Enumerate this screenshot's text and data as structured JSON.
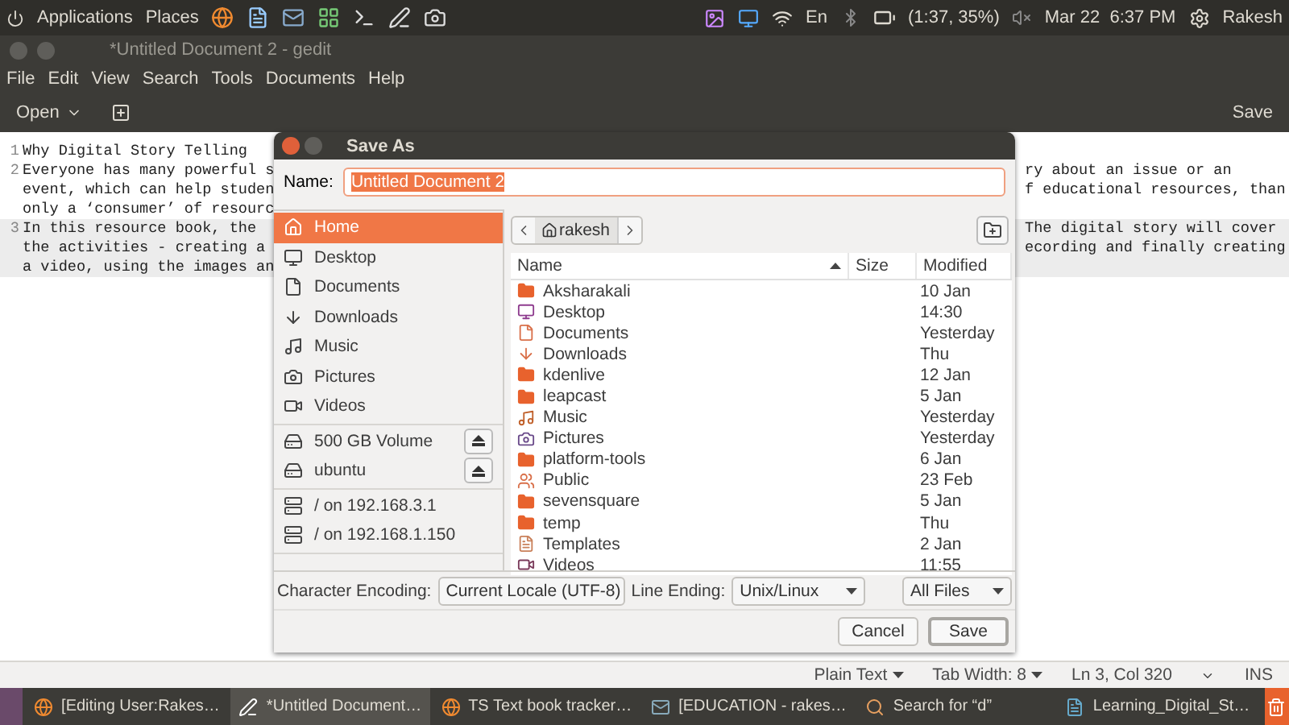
{
  "top_panel": {
    "menus": [
      "Applications",
      "Places"
    ],
    "keyboard": "En",
    "battery": "(1:37, 35%)",
    "clock": "Mar 22  6:37 PM",
    "user": "Rakesh"
  },
  "window": {
    "title": "*Untitled Document 2 - gedit"
  },
  "menu_bar": [
    "File",
    "Edit",
    "View",
    "Search",
    "Tools",
    "Documents",
    "Help"
  ],
  "toolbar": {
    "open": "Open",
    "save": "Save"
  },
  "editor": {
    "lines": [
      {
        "number": "1",
        "current": false,
        "rows": [
          {
            "left": "Why Digital Story Telling"
          }
        ]
      },
      {
        "number": "2",
        "current": false,
        "rows": [
          {
            "left": "Everyone has many powerful s",
            "right": "ry about an issue or an"
          },
          {
            "left": "event, which can help studen",
            "right": "f educational resources, than"
          },
          {
            "left": "only a ‘consumer’ of resourc"
          }
        ]
      },
      {
        "number": "3",
        "current": true,
        "rows": [
          {
            "left": "In this resource book, the ",
            "right": "The digital story will cover"
          },
          {
            "left": "the activities - creating a",
            "right": "ecording and finally creating"
          },
          {
            "left": "a video, using the images an"
          }
        ]
      }
    ]
  },
  "dialog": {
    "title": "Save As",
    "name_label": "Name:",
    "name_value": "Untitled Document 2",
    "name_selected": true,
    "sidebar": [
      [
        {
          "label": "Home",
          "kind": "home",
          "selected": true
        },
        {
          "label": "Desktop",
          "kind": "desktop",
          "selected": false
        },
        {
          "label": "Documents",
          "kind": "documents",
          "selected": false
        },
        {
          "label": "Downloads",
          "kind": "downloads",
          "selected": false
        },
        {
          "label": "Music",
          "kind": "music",
          "selected": false
        },
        {
          "label": "Pictures",
          "kind": "pictures",
          "selected": false
        },
        {
          "label": "Videos",
          "kind": "videos",
          "selected": false
        }
      ],
      [
        {
          "label": "500 GB Volume",
          "kind": "drive",
          "selected": false
        },
        {
          "label": "ubuntu",
          "kind": "drive",
          "selected": false
        }
      ],
      [
        {
          "label": "/ on 192.168.3.1",
          "kind": "network",
          "selected": false
        },
        {
          "label": "/ on 192.168.1.150",
          "kind": "network",
          "selected": false
        }
      ]
    ],
    "path": {
      "crumb": "rakesh"
    },
    "columns": [
      {
        "label": "Name",
        "sorted": true
      },
      {
        "label": "Size",
        "sorted": false
      },
      {
        "label": "Modified",
        "sorted": false
      }
    ],
    "files": [
      {
        "name": "Aksharakali",
        "kind": "folder",
        "modified": "10 Jan"
      },
      {
        "name": "Desktop",
        "kind": "desktop",
        "modified": "14:30"
      },
      {
        "name": "Documents",
        "kind": "documents",
        "modified": "Yesterday"
      },
      {
        "name": "Downloads",
        "kind": "downloads",
        "modified": "Thu"
      },
      {
        "name": "kdenlive",
        "kind": "folder",
        "modified": "12 Jan"
      },
      {
        "name": "leapcast",
        "kind": "folder",
        "modified": "5 Jan"
      },
      {
        "name": "Music",
        "kind": "music",
        "modified": "Yesterday"
      },
      {
        "name": "Pictures",
        "kind": "pictures",
        "modified": "Yesterday"
      },
      {
        "name": "platform-tools",
        "kind": "folder",
        "modified": "6 Jan"
      },
      {
        "name": "Public",
        "kind": "public",
        "modified": "23 Feb"
      },
      {
        "name": "sevensquare",
        "kind": "folder",
        "modified": "5 Jan"
      },
      {
        "name": "temp",
        "kind": "folder",
        "modified": "Thu"
      },
      {
        "name": "Templates",
        "kind": "templates",
        "modified": "2 Jan"
      },
      {
        "name": "Videos",
        "kind": "videos",
        "modified": "11:55"
      }
    ],
    "encoding_label": "Character Encoding:",
    "encoding": "Current Locale (UTF-8)",
    "line_ending_label": "Line Ending:",
    "line_ending": "Unix/Linux",
    "filter": "All Files",
    "buttons": [
      {
        "label": "Cancel",
        "default": false
      },
      {
        "label": "Save",
        "default": true
      }
    ]
  },
  "status_bar": {
    "language": "Plain Text",
    "tab_width": "Tab Width: 8",
    "position": "Ln 3, Col 320",
    "mode": "INS"
  },
  "taskbar": [
    {
      "label": "[Editing User:Rakes…",
      "kind": "browser",
      "selected": false
    },
    {
      "label": "*Untitled Document…",
      "kind": "editor",
      "selected": true
    },
    {
      "label": "TS Text book tracker…",
      "kind": "browser",
      "selected": false
    },
    {
      "label": "[EDUCATION - rakes…",
      "kind": "mail",
      "selected": false
    },
    {
      "label": "Search for “d”",
      "kind": "search",
      "selected": false
    },
    {
      "label": "Learning_Digital_St…",
      "kind": "document",
      "selected": false
    }
  ]
}
